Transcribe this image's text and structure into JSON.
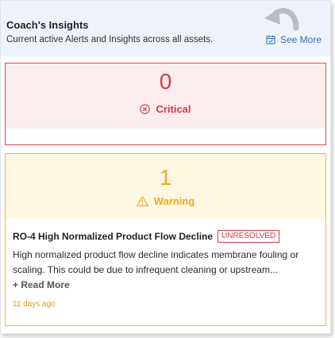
{
  "header": {
    "title": "Coach's Insights",
    "subtitle": "Current active Alerts and Insights across all assets.",
    "see_more_label": "See More",
    "see_more_icon": "calendar-check-icon",
    "decoration_icon": "curved-arrow-icon"
  },
  "critical": {
    "count": "0",
    "label": "Critical",
    "icon": "circle-x-icon",
    "color": "#d93a45",
    "background": "#fbeced"
  },
  "warning": {
    "count": "1",
    "label": "Warning",
    "icon": "warning-triangle-icon",
    "color": "#f0a820",
    "background": "#fef7e1"
  },
  "alert": {
    "title": "RO-4 High Normalized Product Flow Decline",
    "badge": "UNRESOLVED",
    "description": "High normalized product flow decline indicates membrane fouling or scaling. This could be due to infrequent cleaning or upstream...",
    "read_more": "+ Read More",
    "time_ago": "11 days ago"
  },
  "colors": {
    "accent_link": "#2c6fbf",
    "header_background": "#eef3fb"
  }
}
